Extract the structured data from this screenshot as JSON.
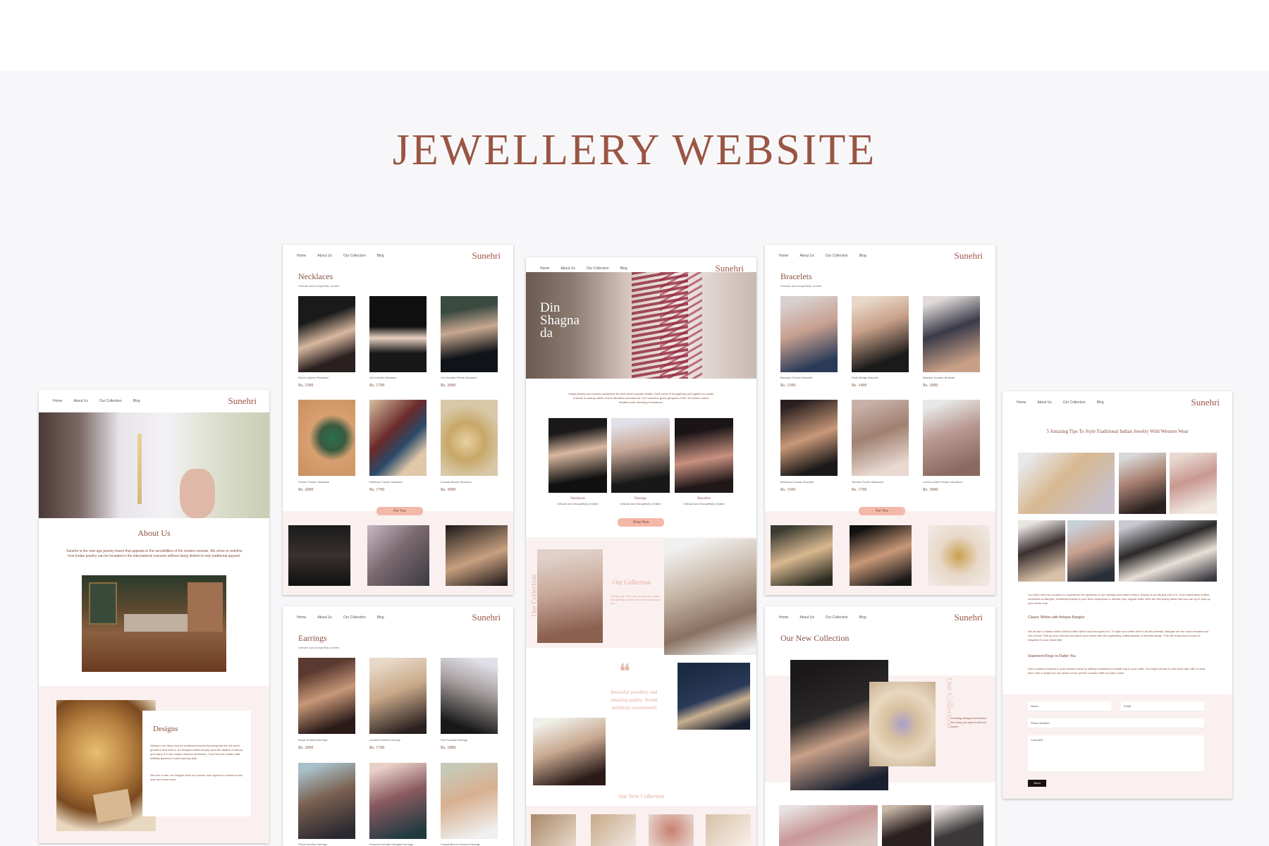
{
  "page": {
    "title": "JEWELLERY WEBSITE"
  },
  "brand": "Sunehri",
  "nav": {
    "home": "Home",
    "about": "About Us",
    "collection": "Our Collection",
    "blog": "Blog"
  },
  "about_page": {
    "heading": "About Us",
    "paragraph": "Sunehri is the new age jewelry brand that appeals to the sensibilities of the modern woman. We strive to redefine how Indian jewelry can be included in the international scenario without being limited to only traditional apparel.",
    "designs_heading": "Designs",
    "designs_p1": "Owing to our deep love for traditional jewelry that bespeak the old world grandeur and charm, our designs reflect deeply upon the depths of history and marry it to the modern fashion aesthetics. You'll see rich Indian craft skillfully garbed in contemporary style.",
    "designs_p2": "We love to see our designs work on a power suit, layered to create a boho look and much more."
  },
  "necklaces_page": {
    "heading": "Necklaces",
    "sub": "Delicate and thoughtfully created",
    "products": [
      {
        "name": "Moon Layered Necklace",
        "price": "Rs. 1500"
      },
      {
        "name": "Uni Kundan Necklace",
        "price": "Rs. 1700"
      },
      {
        "name": "Lim Kundan Pearls Necklace",
        "price": "Rs. 2000"
      },
      {
        "name": "Pendel Choker Necklace",
        "price": "Rs. 2000"
      },
      {
        "name": "Rainbow Choker Necklace",
        "price": "Rs. 1700"
      },
      {
        "name": "Kundan Bloom Necklace",
        "price": "Rs. 3000"
      }
    ],
    "for_you": "For You"
  },
  "earrings_page": {
    "heading": "Earrings",
    "sub": "Delicate and thoughtfully created",
    "products": [
      {
        "name": "Royal Jhumka Earrings",
        "price": "Rs. 2000"
      },
      {
        "name": "Lamali Sunetea Earrings",
        "price": "Rs. 1700"
      },
      {
        "name": "Pari Kundan Earrings",
        "price": "Rs. 1800"
      },
      {
        "name": "Phool Kundan Earrings",
        "price": ""
      },
      {
        "name": "Peacock Kundan Danglad Earrings",
        "price": ""
      },
      {
        "name": "Crystal Bloom Kundan Earrings",
        "price": ""
      }
    ]
  },
  "home_page": {
    "hero": "Din Shagna da",
    "intro": "Indian jewelry and modern aesthetics fill each other's golden details. Each piece is thoughtfully put together to create a sense of beauty within, that is effortless and tailored. Our collection gives glimpses of the rich Indian culture tinsalled with charming innovations.",
    "categories": [
      {
        "name": "Necklaces",
        "sub": "Delicate and thoughtfully created"
      },
      {
        "name": "Earrings",
        "sub": "Delicate and thoughtfully created"
      },
      {
        "name": "Bracelets",
        "sub": "Delicate and thoughtfully created"
      }
    ],
    "shop_now": "Shop Now",
    "collection_vertical": "Our Collection",
    "collection_heading": "Our Collection",
    "collection_text": "Sift through the many stories we create, thoughtfully curated and seamlessly put you.",
    "quote_mark": "❝",
    "quote": "Beautiful jewellery and amazing quality. Would definitely recommend!",
    "new_collection": "Our New Collection"
  },
  "bracelets_page": {
    "heading": "Bracelets",
    "sub": "Delicate and thoughtfully created",
    "products": [
      {
        "name": "Baroque Choker Bracelet",
        "price": "Rs. 1500"
      },
      {
        "name": "Pearl Bridge Bracelet",
        "price": "Rs. 1400"
      },
      {
        "name": "Bhaskar Kundan Bracelet",
        "price": "Rs. 2000"
      },
      {
        "name": "Maharani Kundan Bracelet",
        "price": "Rs. 1500"
      },
      {
        "name": "Tamara Pearls Hathphool",
        "price": "Rs. 1700"
      },
      {
        "name": "Lotus Kundan Pearls Hathphool",
        "price": "Rs. 3000"
      }
    ],
    "for_you": "For You"
  },
  "new_collection_page": {
    "heading": "Our New Collection",
    "vertical": "Our Collection",
    "text": "Creating designs that weave the story you want to tell the world."
  },
  "blog_page": {
    "title": "5 Amazing Tips To Style Traditional Indian Jewelry With Western Wear",
    "p1": "You don't need an occasion to experience the opulence of our heritage and culture where Jewelry is an integral part of it. From elaborately crafted necklaces to Bangles, traditional jewelry is your best companion to elevate your regular outfit. Here are few quirky ideas that you can try to amp up your whole look.",
    "h1": "Classic Whites with Antique Bangles",
    "p2": "We all own a classic white shirt but often fail to add that spark to it. To style your white shirt to its full potential, Bangles are the most versatile and chic choice. Roll up your sleeves and adorn your wrists with the captivating craftsmanship of intricate kadas. This will surely add a touch of elegance to your ensemble.",
    "h2": "Statement Rings to Flatter You",
    "p3": "Add a splash of drama to your western wear by adding a statement cocktail ring to your outfit. You might choose to pair them with LBD or wear them with a simple tee and jeans for the perfect comfort outfit but with a twist.",
    "form": {
      "name": "Name",
      "email": "Email",
      "phone": "Phone Number",
      "comment": "Comment",
      "send": "Send"
    }
  },
  "colors": {
    "accent": "#9a5543",
    "pill": "#f3b8a8",
    "pink_bg": "#fbf0f0",
    "background": "#f7f7f9"
  }
}
